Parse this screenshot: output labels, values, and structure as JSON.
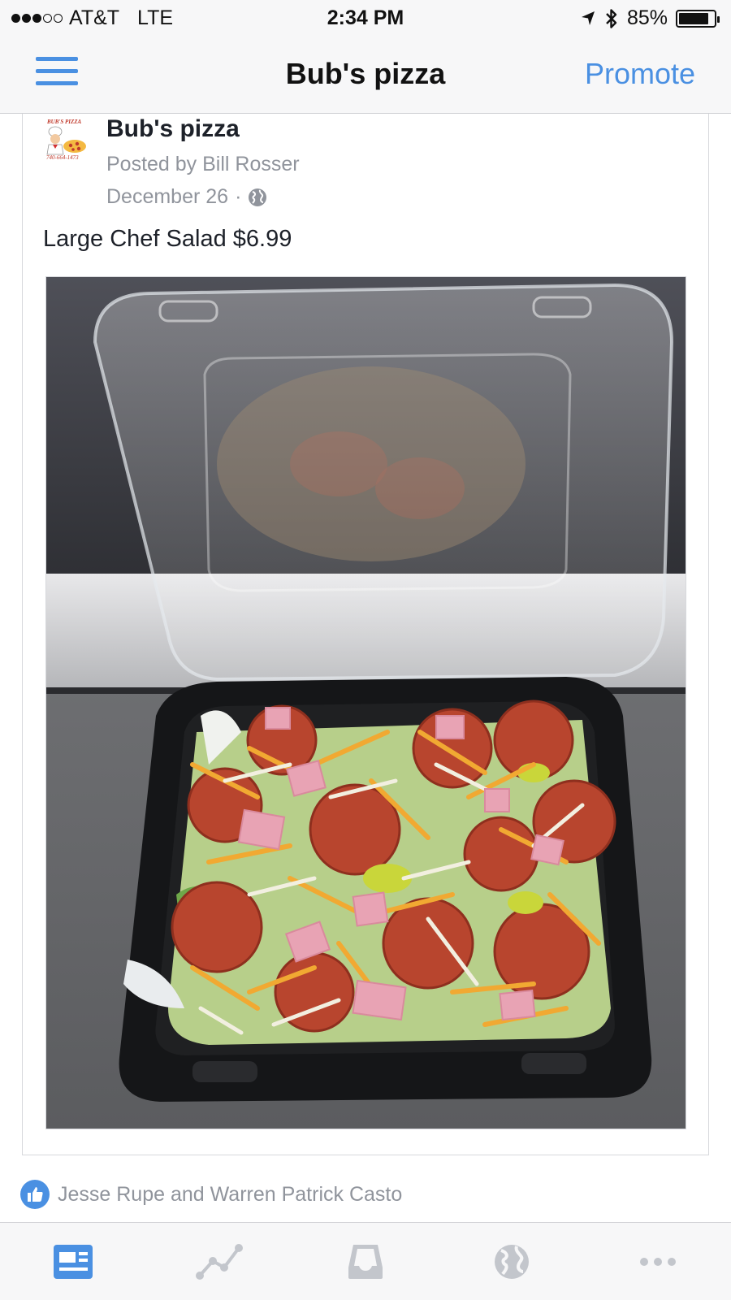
{
  "status_bar": {
    "carrier": "AT&T",
    "network": "LTE",
    "time": "2:34 PM",
    "battery_percent": "85%",
    "battery_level": 0.85,
    "signal_bars_filled": 3,
    "signal_bars_total": 5,
    "icons": [
      "location-arrow-icon",
      "bluetooth-icon",
      "battery-icon"
    ]
  },
  "nav": {
    "title": "Bub's pizza",
    "promote_label": "Promote",
    "menu_icon": "hamburger-menu-icon"
  },
  "post": {
    "logo": {
      "title": "BUB'S PIZZA",
      "phone": "740-664-1473"
    },
    "page_name": "Bub's pizza",
    "posted_by": "Posted by Bill Rosser",
    "date": "December 26",
    "separator": "·",
    "privacy_icon": "globe-icon",
    "text": "Large Chef Salad $6.99",
    "photo_icon": "chef-salad-photo"
  },
  "reactions": {
    "text": "Jesse Rupe and Warren Patrick Casto",
    "icon": "like-thumb-icon"
  },
  "tab_bar": {
    "active_color": "#4a90e2",
    "inactive_color": "#c3c6cc",
    "tabs": [
      {
        "icon": "news-feed-icon",
        "active": true
      },
      {
        "icon": "insights-chart-icon",
        "active": false
      },
      {
        "icon": "inbox-tray-icon",
        "active": false
      },
      {
        "icon": "globe-icon",
        "active": false
      },
      {
        "icon": "more-dots-icon",
        "active": false
      }
    ]
  },
  "colors": {
    "accent": "#4a90e2",
    "meta_text": "#90949c",
    "primary_text": "#1d2129",
    "bar_background": "#f7f7f8"
  }
}
